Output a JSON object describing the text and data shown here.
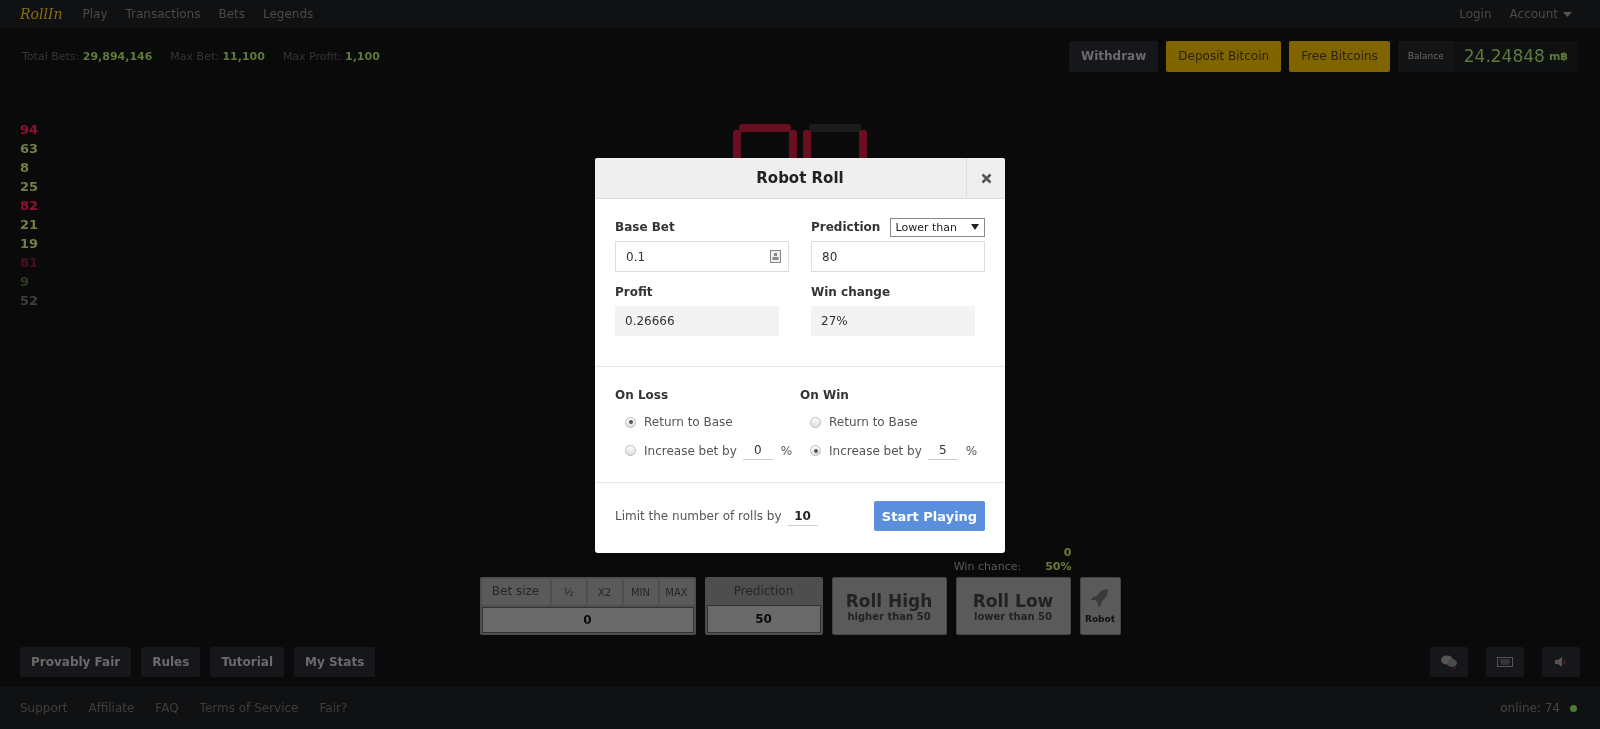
{
  "nav": {
    "logo": "RollIn",
    "links": [
      "Play",
      "Transactions",
      "Bets",
      "Legends"
    ],
    "login": "Login",
    "account": "Account"
  },
  "stats": [
    {
      "label": "Total Bets:",
      "value": "29,894,146"
    },
    {
      "label": "Max Bet:",
      "value": "11,100"
    },
    {
      "label": "Max Profit:",
      "value": "1,100"
    }
  ],
  "actions": [
    {
      "label": "Withdraw",
      "kind": "dark"
    },
    {
      "label": "Deposit Bitcoin",
      "kind": "gold"
    },
    {
      "label": "Free Bitcoins",
      "kind": "gold"
    }
  ],
  "balance": {
    "label": "Balance",
    "value": "24.24848",
    "unit": "m฿"
  },
  "history": [
    {
      "value": "94",
      "color": "#8e1230"
    },
    {
      "value": "63",
      "color": "#6f8043"
    },
    {
      "value": "8",
      "color": "#6f8043"
    },
    {
      "value": "25",
      "color": "#6f8043"
    },
    {
      "value": "82",
      "color": "#8e1230"
    },
    {
      "value": "21",
      "color": "#6f8043"
    },
    {
      "value": "19",
      "color": "#6f8043"
    },
    {
      "value": "81",
      "color": "#4a1020"
    },
    {
      "value": "9",
      "color": "#2d3d22"
    },
    {
      "value": "52",
      "color": "#3c403c"
    }
  ],
  "readout": {
    "value": "0",
    "win_chance_label": "Win chance:",
    "win_chance": "50%"
  },
  "controls": {
    "bet_size": {
      "label": "Bet size",
      "buttons": [
        "½",
        "X2",
        "MIN",
        "MAX"
      ],
      "value": "0"
    },
    "prediction": {
      "label": "Prediction",
      "value": "50"
    },
    "rolls": [
      {
        "title": "Roll High",
        "subtitle": "higher than 50"
      },
      {
        "title": "Roll Low",
        "subtitle": "lower than 50"
      }
    ],
    "robot": {
      "label": "Robot"
    }
  },
  "bottom_buttons": [
    "Provably Fair",
    "Rules",
    "Tutorial",
    "My Stats"
  ],
  "footer": {
    "links": [
      "Support",
      "Affiliate",
      "FAQ",
      "Terms of Service",
      "Fair?"
    ],
    "online": "online: 74"
  },
  "modal": {
    "title": "Robot Roll",
    "base_bet": {
      "label": "Base Bet",
      "value": "0.1"
    },
    "prediction": {
      "label": "Prediction",
      "mode": "Lower than",
      "value": "80"
    },
    "profit": {
      "label": "Profit",
      "value": "0.26666"
    },
    "win_change": {
      "label": "Win change",
      "value": "27%"
    },
    "groups": [
      {
        "title": "On Loss",
        "options": [
          {
            "kind": "return",
            "label": "Return to Base",
            "selected": true
          },
          {
            "kind": "increase",
            "label": "Increase bet by",
            "value": "0",
            "unit": "%",
            "selected": false
          }
        ]
      },
      {
        "title": "On Win",
        "options": [
          {
            "kind": "return",
            "label": "Return to Base",
            "selected": false
          },
          {
            "kind": "increase",
            "label": "Increase bet by",
            "value": "5",
            "unit": "%",
            "selected": true
          }
        ]
      }
    ],
    "limit": {
      "label": "Limit the number of rolls by",
      "value": "10"
    },
    "start": "Start Playing"
  }
}
